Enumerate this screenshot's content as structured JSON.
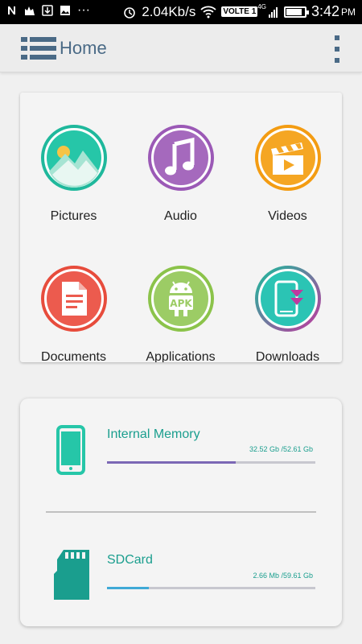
{
  "status_bar": {
    "speed": "2.04Kb/s",
    "network_badge": "VOLTE 1",
    "net_type": "4G",
    "time": "3:42",
    "ampm": "PM",
    "battery_level": 0.8
  },
  "app_bar": {
    "title": "Home"
  },
  "categories": [
    {
      "label": "Pictures",
      "icon": "pictures-icon",
      "color": "#1fb89c"
    },
    {
      "label": "Audio",
      "icon": "audio-icon",
      "color": "#9b59b6"
    },
    {
      "label": "Videos",
      "icon": "videos-icon",
      "color": "#f39c12"
    },
    {
      "label": "Documents",
      "icon": "documents-icon",
      "color": "#e74c3c"
    },
    {
      "label": "Applications",
      "icon": "applications-icon",
      "color": "#8bc34a"
    },
    {
      "label": "Downloads",
      "icon": "downloads-icon",
      "color": "#1abc9c"
    }
  ],
  "storage": [
    {
      "name": "Internal Memory",
      "size": "32.52 Gb /52.61 Gb",
      "used_fraction": 0.618,
      "bar_color": "#7b68b5",
      "icon": "phone-icon"
    },
    {
      "name": "SDCard",
      "size": "2.66 Mb /59.61 Gb",
      "used_fraction": 0.2,
      "bar_color": "#3fa9d6",
      "icon": "sdcard-icon"
    }
  ]
}
